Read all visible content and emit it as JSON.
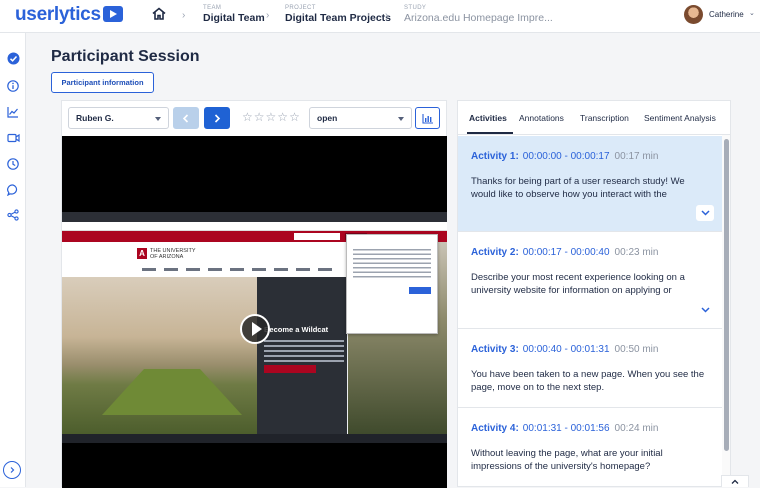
{
  "brand": {
    "logo_text": "userlytics"
  },
  "breadcrumb": [
    {
      "key": "TEAM",
      "value": "Digital Team"
    },
    {
      "key": "PROJECT",
      "value": "Digital Team Projects"
    },
    {
      "key": "STUDY",
      "value": "Arizona.edu Homepage Impre..."
    }
  ],
  "user": {
    "name": "Catherine"
  },
  "page": {
    "title": "Participant Session",
    "participant_info_button": "Participant information"
  },
  "session": {
    "participant": "Ruben G.",
    "status": "open",
    "rating_stars": 5,
    "rating_value": 0
  },
  "video_screen": {
    "site_heading": "Become a Wildcat",
    "university_name_line1": "THE UNIVERSITY",
    "university_name_line2": "OF ARIZONA"
  },
  "tabs": [
    "Activities",
    "Annotations",
    "Transcription",
    "Sentiment Analysis"
  ],
  "activities": [
    {
      "label": "Activity 1:",
      "range": "00:00:00 - 00:00:17",
      "duration": "00:17 min",
      "text": "Thanks for being part of a user research study! We would like to observe how you interact with the"
    },
    {
      "label": "Activity 2:",
      "range": "00:00:17 - 00:00:40",
      "duration": "00:23 min",
      "text": "Describe your most recent experience looking on a university website for information on applying or"
    },
    {
      "label": "Activity 3:",
      "range": "00:00:40 - 00:01:31",
      "duration": "00:50 min",
      "text": "You have been taken to a new page. When you see the page, move on to the next step."
    },
    {
      "label": "Activity 4:",
      "range": "00:01:31 - 00:01:56",
      "duration": "00:24 min",
      "text": "Without leaving the page, what are your initial impressions of the university's homepage?"
    }
  ],
  "colors": {
    "accent": "#2b62d9",
    "selected_activity_bg": "#dbeaf9",
    "site_red": "#ab0520"
  }
}
